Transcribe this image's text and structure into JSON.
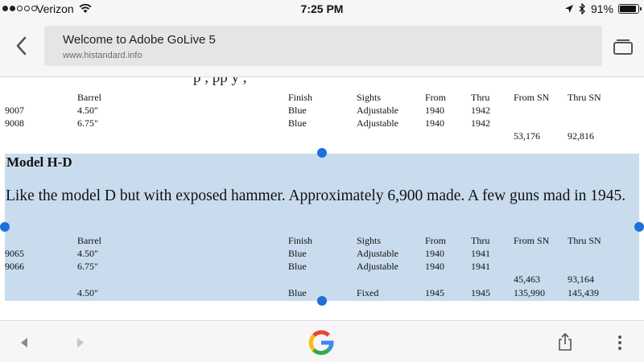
{
  "status_bar": {
    "carrier": "Verizon",
    "time": "7:25 PM",
    "battery": "91%",
    "battery_level": 0.91,
    "signal_bars_filled": 2,
    "signal_bars_total": 5
  },
  "toolbar": {
    "page_title": "Welcome to Adobe GoLive 5",
    "url": "www.histandard.info"
  },
  "content": {
    "clipped_text": "p                                                      , pp        y      ,",
    "table1": {
      "headers": {
        "barrel": "Barrel",
        "finish": "Finish",
        "sights": "Sights",
        "from": "From",
        "thru": "Thru",
        "from_sn": "From SN",
        "thru_sn": "Thru SN"
      },
      "rows": [
        {
          "model": "9007",
          "barrel": "4.50\"",
          "finish": "Blue",
          "sights": "Adjustable",
          "from": "1940",
          "thru": "1942"
        },
        {
          "model": "9008",
          "barrel": "6.75\"",
          "finish": "Blue",
          "sights": "Adjustable",
          "from": "1940",
          "thru": "1942"
        }
      ],
      "sn_row": {
        "from_sn": "53,176",
        "thru_sn": "92,816"
      }
    },
    "model_title": "Model H-D",
    "description": "Like the model D but with exposed hammer. Approximately 6,900 made. A few guns mad in 1945.",
    "table2": {
      "headers": {
        "barrel": "Barrel",
        "finish": "Finish",
        "sights": "Sights",
        "from": "From",
        "thru": "Thru",
        "from_sn": "From SN",
        "thru_sn": "Thru SN"
      },
      "rows": [
        {
          "model": "9065",
          "barrel": "4.50\"",
          "finish": "Blue",
          "sights": "Adjustable",
          "from": "1940",
          "thru": "1941"
        },
        {
          "model": "9066",
          "barrel": "6.75\"",
          "finish": "Blue",
          "sights": "Adjustable",
          "from": "1940",
          "thru": "1941"
        }
      ],
      "sn_row": {
        "from_sn": "45,463",
        "thru_sn": "93,164"
      },
      "last_row": {
        "barrel": "4.50\"",
        "finish": "Blue",
        "sights": "Fixed",
        "from": "1945",
        "thru": "1945",
        "from_sn": "135,990",
        "thru_sn": "145,439"
      }
    }
  },
  "colors": {
    "selection": "#c9dcee",
    "selection_handle": "#1e6fd9",
    "chrome_bg": "#f6f6f6",
    "url_box": "#e5e5e5"
  },
  "icons": {
    "back": "chevron-left-icon",
    "tabs": "tab-switcher-icon",
    "nav_back": "triangle-left-icon",
    "nav_forward": "triangle-right-icon",
    "google": "google-g-icon",
    "share": "share-icon",
    "more": "more-vertical-icon"
  }
}
